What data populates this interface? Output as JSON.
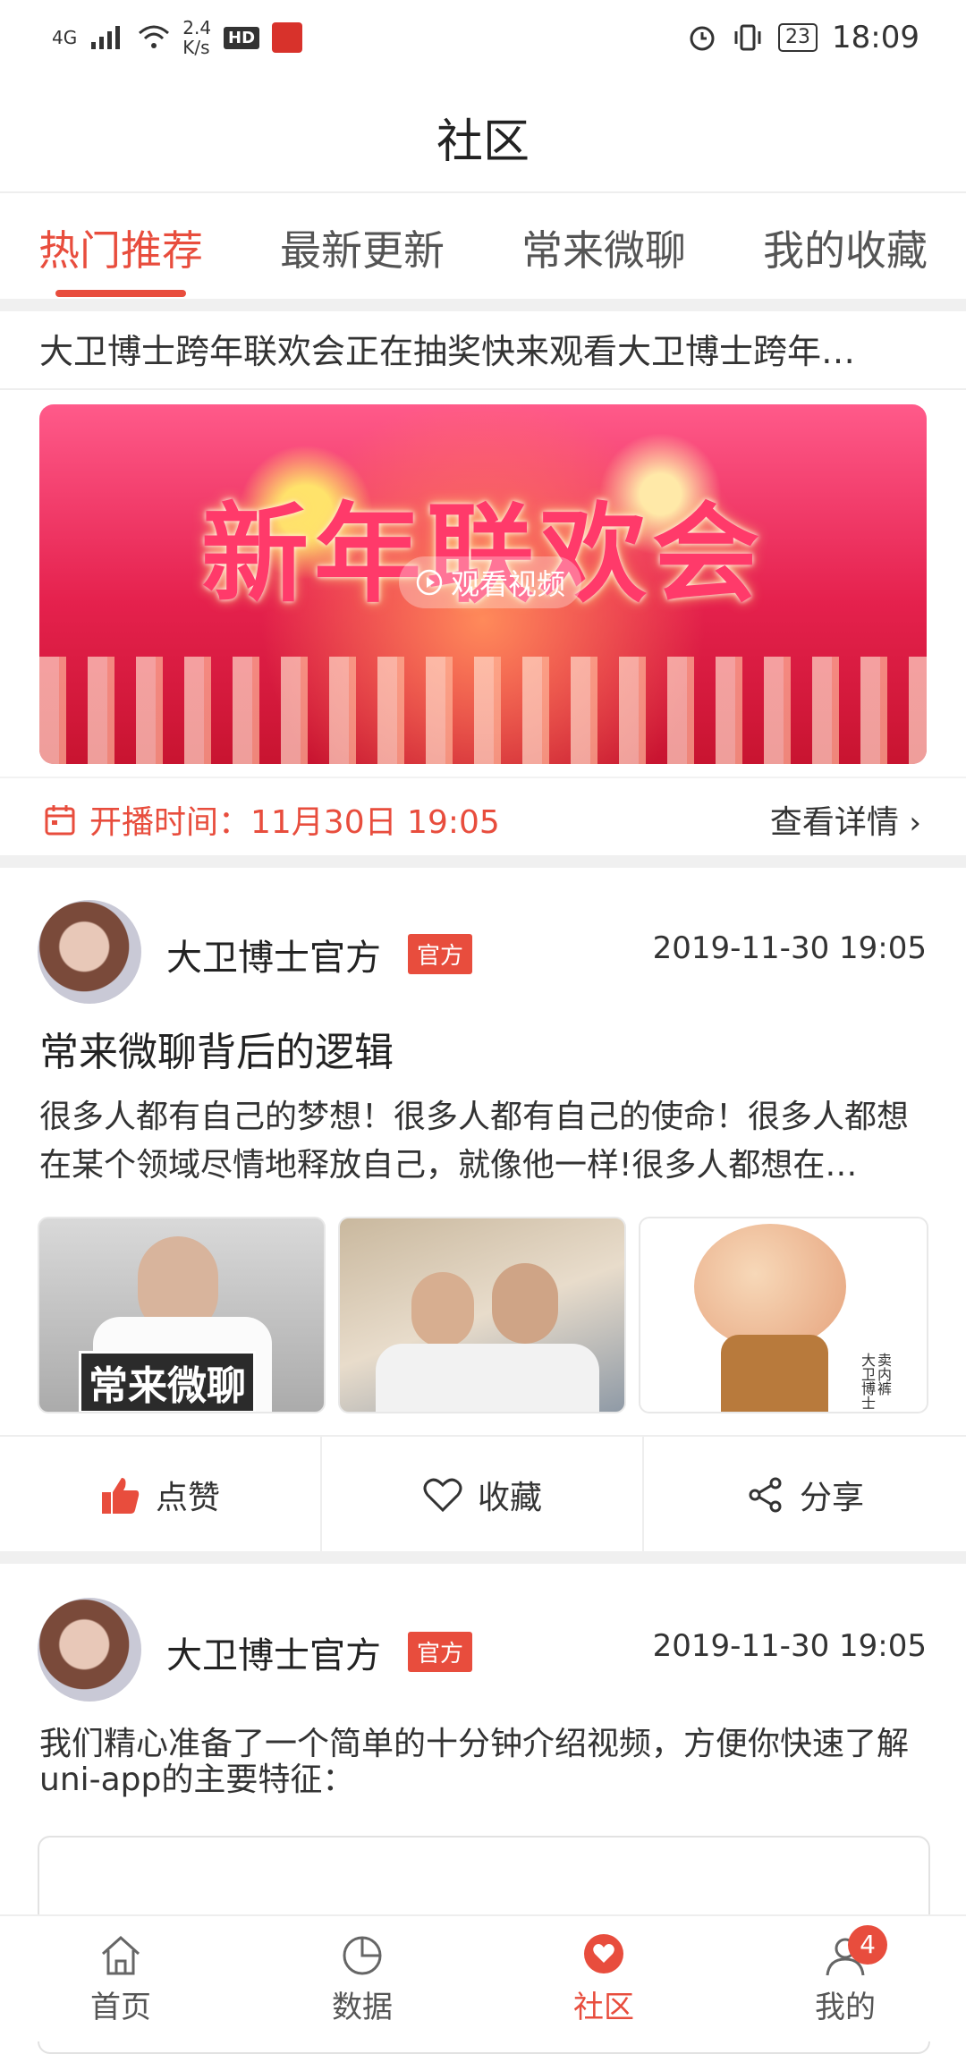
{
  "status": {
    "network": "4G",
    "speed_value": "2.4",
    "speed_unit": "K/s",
    "hd": "HD",
    "battery": "23",
    "time": "18:09"
  },
  "header": {
    "title": "社区"
  },
  "tabs": [
    {
      "label": "热门推荐",
      "active": true
    },
    {
      "label": "最新更新"
    },
    {
      "label": "常来微聊"
    },
    {
      "label": "我的收藏"
    }
  ],
  "notice": "大卫博士跨年联欢会正在抽奖快来观看大卫博士跨年…",
  "banner": {
    "title": "新年联欢会",
    "play_label": "观看视频"
  },
  "live": {
    "time_label": "开播时间：11月30日 19:05",
    "detail_label": "查看详情"
  },
  "posts": [
    {
      "author": "大卫博士官方",
      "badge": "官方",
      "date": "2019-11-30 19:05",
      "title": "常来微聊背后的逻辑",
      "body": "很多人都有自己的梦想！很多人都有自己的使命！很多人都想在某个领域尽情地释放自己，就像他一样!很多人都想在…",
      "thumb1_caption": "常来微聊",
      "thumb3_caption": "卖内裤 大卫博士"
    },
    {
      "author": "大卫博士官方",
      "badge": "官方",
      "date": "2019-11-30 19:05",
      "body": "我们精心准备了一个简单的十分钟介绍视频，方便你快速了解uni-app的主要特征："
    }
  ],
  "actions": {
    "like": "点赞",
    "favorite": "收藏",
    "share": "分享"
  },
  "tabbar": [
    {
      "label": "首页",
      "icon": "home-icon"
    },
    {
      "label": "数据",
      "icon": "pie-chart-icon"
    },
    {
      "label": "社区",
      "icon": "heart-chat-icon",
      "active": true
    },
    {
      "label": "我的",
      "icon": "user-icon",
      "badge": "4"
    }
  ],
  "colors": {
    "accent": "#e84d3d"
  }
}
